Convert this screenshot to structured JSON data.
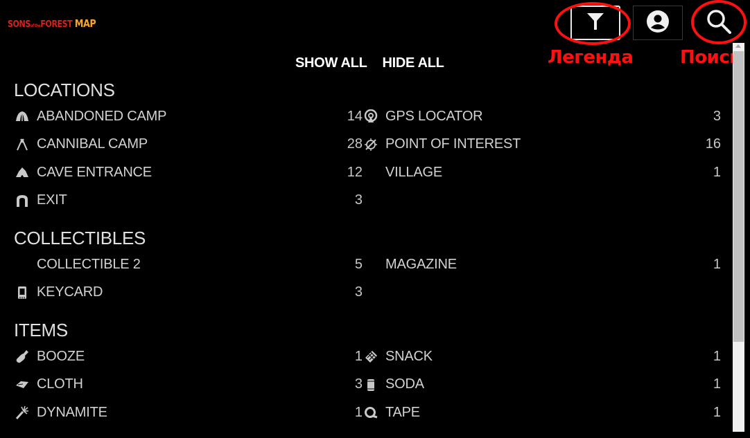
{
  "app": {
    "logo": {
      "part1": "SONS",
      "part_small": "of the",
      "part2": "FOREST",
      "part3": "MAP"
    }
  },
  "toolbar": {
    "legend_icon": "filter-icon",
    "account_icon": "account-icon",
    "search_icon": "search-icon"
  },
  "annotations": {
    "legend_label": "Легенда",
    "search_label": "Поиск",
    "color": "#ff1010"
  },
  "controls": {
    "show_all": "SHOW ALL",
    "hide_all": "HIDE ALL"
  },
  "sections": [
    {
      "title": "LOCATIONS",
      "left": [
        {
          "label": "ABANDONED CAMP",
          "count": "14",
          "icon": "tent-icon"
        },
        {
          "label": "CANNIBAL CAMP",
          "count": "28",
          "icon": "teepee-icon"
        },
        {
          "label": "CAVE ENTRANCE",
          "count": "12",
          "icon": "cave-icon"
        },
        {
          "label": "EXIT",
          "count": "3",
          "icon": "arch-icon"
        }
      ],
      "right": [
        {
          "label": "GPS LOCATOR",
          "count": "3",
          "icon": "gps-icon"
        },
        {
          "label": "POINT OF INTEREST",
          "count": "16",
          "icon": "compass-icon"
        },
        {
          "label": "VILLAGE",
          "count": "1",
          "icon": ""
        }
      ]
    },
    {
      "title": "COLLECTIBLES",
      "left": [
        {
          "label": "COLLECTIBLE 2",
          "count": "5",
          "icon": ""
        },
        {
          "label": "KEYCARD",
          "count": "3",
          "icon": "keycard-icon"
        }
      ],
      "right": [
        {
          "label": "MAGAZINE",
          "count": "1",
          "icon": ""
        }
      ]
    },
    {
      "title": "ITEMS",
      "left": [
        {
          "label": "BOOZE",
          "count": "1",
          "icon": "bottle-icon"
        },
        {
          "label": "CLOTH",
          "count": "3",
          "icon": "cloth-icon"
        },
        {
          "label": "DYNAMITE",
          "count": "1",
          "icon": "dynamite-icon"
        }
      ],
      "right": [
        {
          "label": "SNACK",
          "count": "1",
          "icon": "snack-icon"
        },
        {
          "label": "SODA",
          "count": "1",
          "icon": "soda-icon"
        },
        {
          "label": "TAPE",
          "count": "1",
          "icon": "tape-icon"
        }
      ]
    }
  ]
}
